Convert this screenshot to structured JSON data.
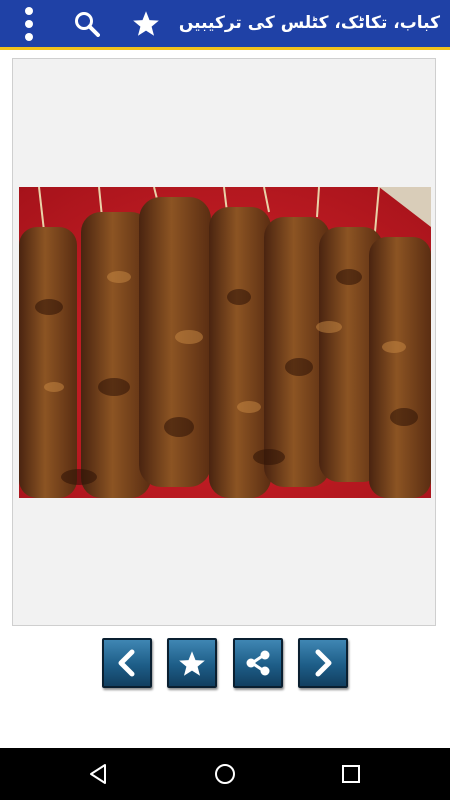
{
  "app_bar": {
    "title": "کباب، تکاٹک، کٹلس کی ترکیبیں",
    "background": "#1f41a6",
    "accent_line": "#f2c21a",
    "icons": [
      "more-vert-icon",
      "search-icon",
      "star-icon"
    ]
  },
  "content": {
    "image_subject": "grilled kebab skewers on red plate"
  },
  "controls": {
    "buttons": [
      "previous-icon",
      "favorite-star-icon",
      "share-icon",
      "next-icon"
    ],
    "button_color": "#1d5d87"
  },
  "system_nav": {
    "buttons": [
      "back-icon",
      "home-icon",
      "recents-icon"
    ]
  }
}
